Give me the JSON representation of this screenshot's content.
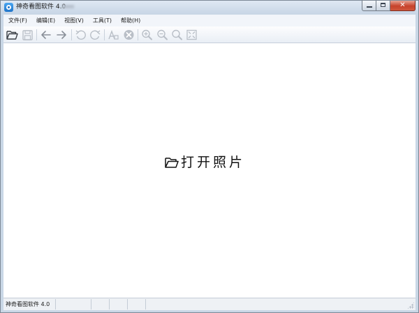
{
  "window": {
    "title": "神奇看图软件 4.0"
  },
  "caption_buttons": {
    "minimize_icon": "minimize-icon",
    "maximize_icon": "maximize-icon",
    "close_glyph": "✕"
  },
  "menu": [
    {
      "label": "文件(F)"
    },
    {
      "label": "编辑(E)"
    },
    {
      "label": "视图(V)"
    },
    {
      "label": "工具(T)"
    },
    {
      "label": "帮助(H)"
    }
  ],
  "toolbar": {
    "icons": [
      "open-folder-icon",
      "save-icon",
      "back-arrow-icon",
      "forward-arrow-icon",
      "rotate-left-icon",
      "rotate-right-icon",
      "text-recognize-icon",
      "delete-icon",
      "zoom-in-icon",
      "zoom-out-icon",
      "actual-size-icon",
      "fit-window-icon"
    ]
  },
  "main": {
    "open_photo_label": "打开照片"
  },
  "statusbar": {
    "app_version": "神奇看图软件 4.0"
  },
  "colors": {
    "accent": "#1f74c9",
    "close_button": "#c6422b",
    "toolbar_icon_active": "#3a3f45",
    "toolbar_icon_disabled": "#b9bfc7"
  }
}
